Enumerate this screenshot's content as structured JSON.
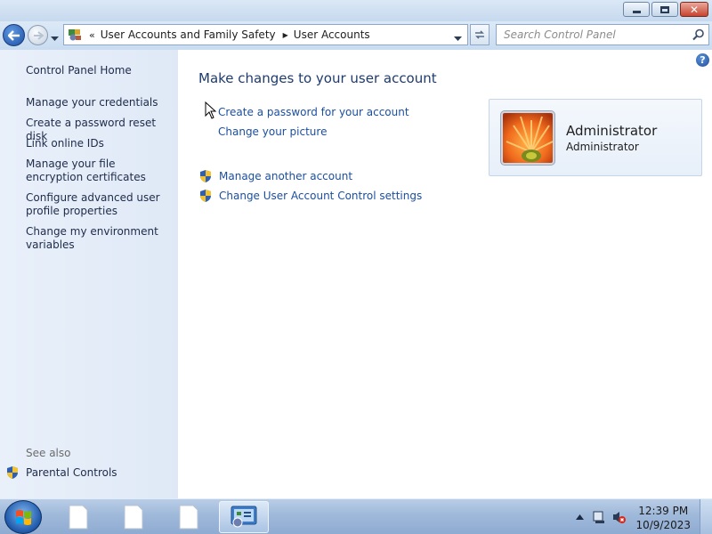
{
  "window": {
    "minimize_label": "",
    "maximize_label": "",
    "close_label": "✕"
  },
  "nav": {
    "chevrons": "«",
    "breadcrumbs": [
      "User Accounts and Family Safety",
      "User Accounts"
    ],
    "search_placeholder": "Search Control Panel"
  },
  "sidebar": {
    "items": [
      "Control Panel Home",
      "Manage your credentials",
      "Create a password reset disk",
      "Link online IDs",
      "Manage your file encryption certificates",
      "Configure advanced user profile properties",
      "Change my environment variables"
    ],
    "see_also_label": "See also",
    "see_also_items": [
      "Parental Controls"
    ]
  },
  "main": {
    "heading": "Make changes to your user account",
    "tasks": [
      "Create a password for your account",
      "Change your picture"
    ],
    "shield_tasks": [
      "Manage another account",
      "Change User Account Control settings"
    ],
    "account": {
      "name": "Administrator",
      "type": "Administrator"
    }
  },
  "taskbar": {
    "time": "12:39 PM",
    "date": "10/9/2023"
  }
}
